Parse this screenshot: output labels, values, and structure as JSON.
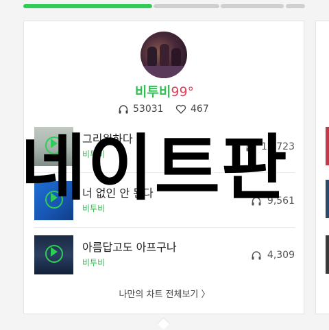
{
  "colors": {
    "accent": "#2fcd57",
    "temp": "#e0405a"
  },
  "artist": {
    "name": "비투비",
    "temperature": "99°"
  },
  "stats": {
    "plays": "53031",
    "likes": "467",
    "plays_icon": "headphone-icon",
    "likes_icon": "heart-icon"
  },
  "tracks": [
    {
      "title": "그리워하다",
      "artist": "비투비",
      "plays": "12,723"
    },
    {
      "title": "너 없인 안 된다",
      "artist": "비투비",
      "plays": "9,561"
    },
    {
      "title": "아름답고도 아프구나",
      "artist": "비투비",
      "plays": "4,309"
    }
  ],
  "more_link": "나만의 차트 전체보기 〉",
  "overlay": "네이트판"
}
